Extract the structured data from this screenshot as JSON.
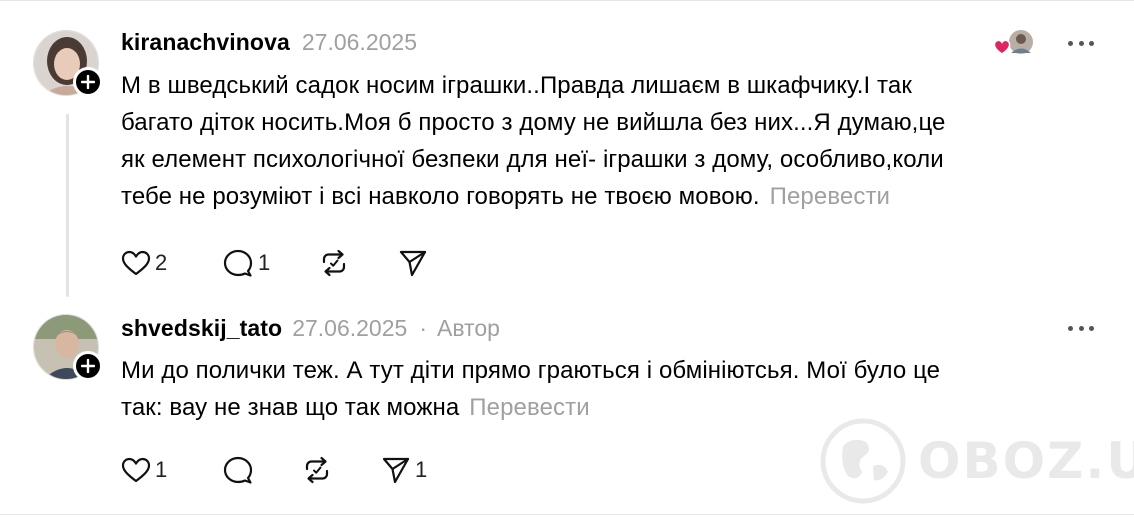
{
  "comments": [
    {
      "username": "kiranachvinova",
      "date": "27.06.2025",
      "lines": [
        "М в шведський садок носим іграшки..Правда лишаєм в шкафчику.І так",
        "багато діток носить.Моя б просто з дому не вийшла без них...Я думаю,це",
        "як елемент психологічної безпеки для неї- іграшки з дому, особливо,коли",
        "тебе не розуміют і всі навколо говорять не твоєю мовою."
      ],
      "translate": "Перевести",
      "likes": "2",
      "replies": "1",
      "reposts": "",
      "shares": "",
      "liked_by_author": true
    },
    {
      "username": "shvedskij_tato",
      "date": "27.06.2025",
      "dot": "·",
      "author_badge": "Автор",
      "lines": [
        "Ми до полички теж. А тут діти прямо граються і обмініютсья. Мої було це",
        "так: вау не знав що так можна"
      ],
      "translate": "Перевести",
      "likes": "1",
      "replies": "",
      "reposts": "",
      "shares": "1"
    }
  ],
  "icons": {
    "like": "heart-icon",
    "reply": "comment-icon",
    "repost": "repost-icon",
    "share": "send-icon",
    "more": "more-icon",
    "follow": "plus-icon"
  },
  "watermark": "OBOZ.UA",
  "colors": {
    "muted": "#a0a0a0",
    "heart": "#e0245e",
    "text": "#000000"
  }
}
